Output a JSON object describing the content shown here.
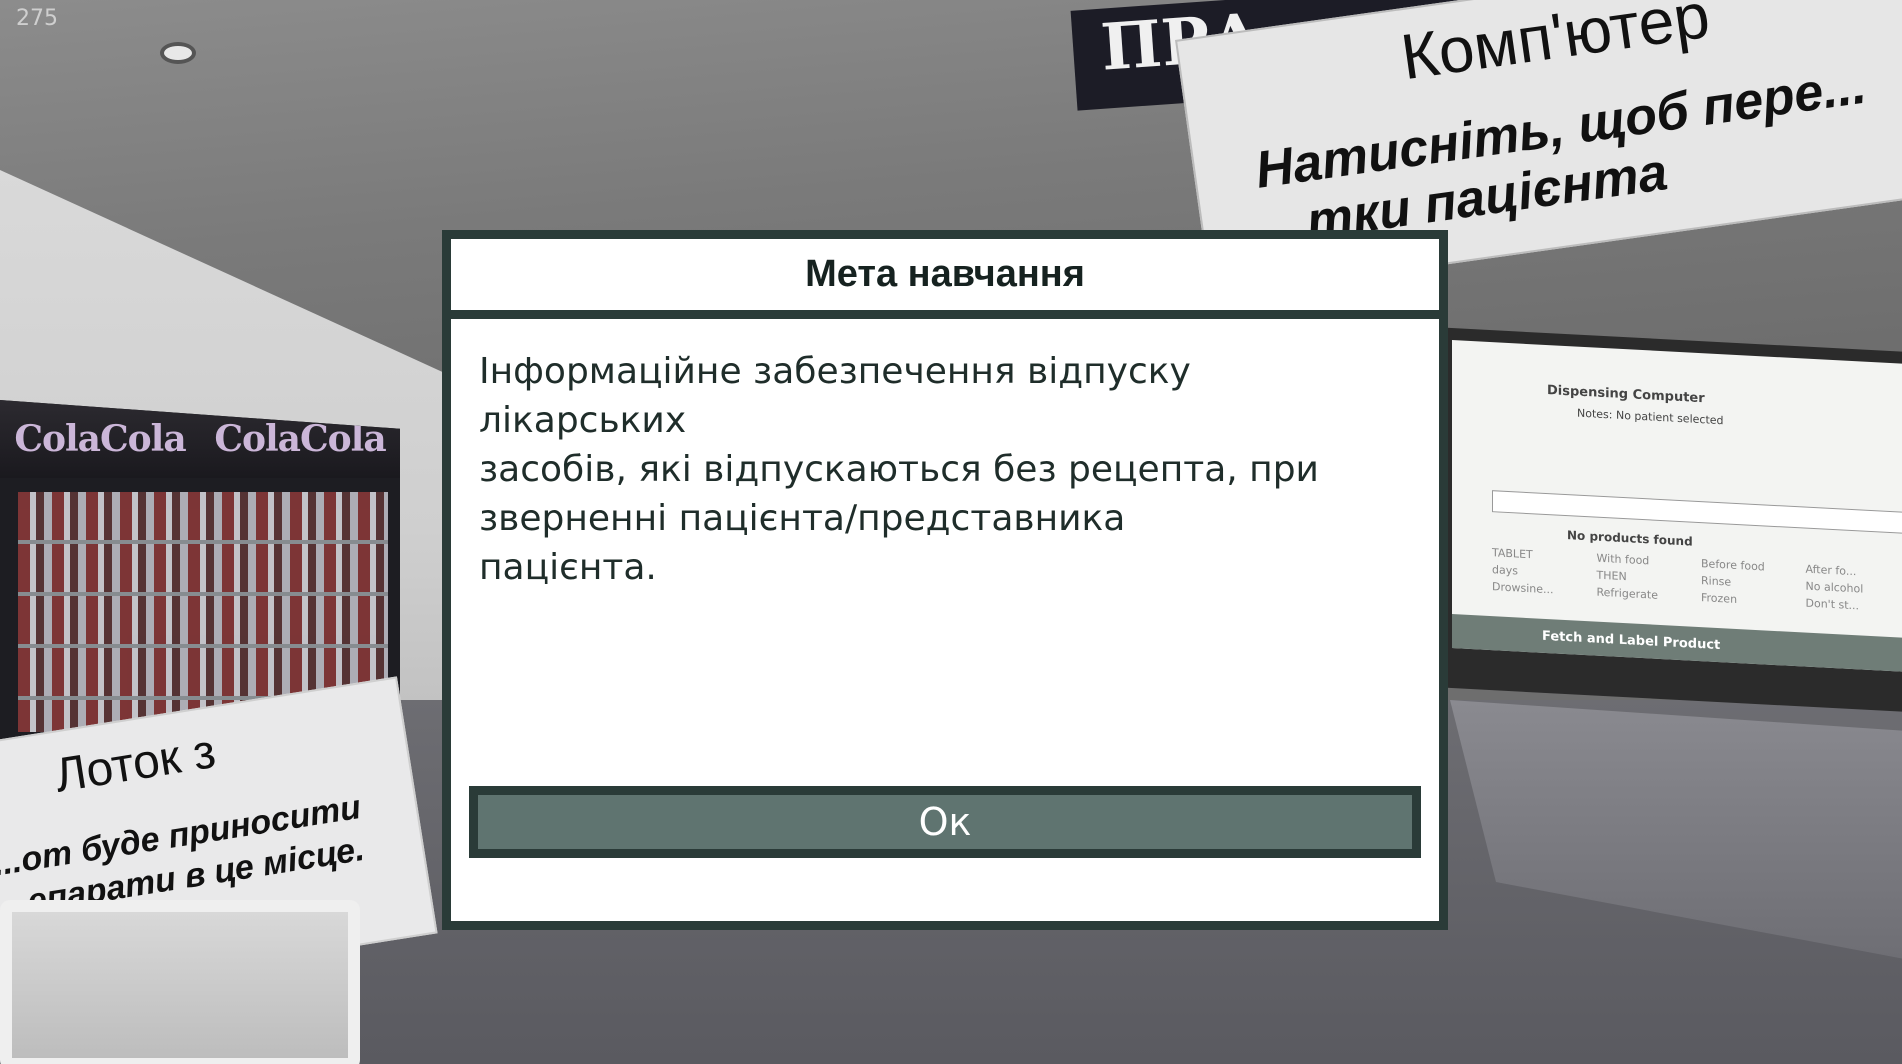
{
  "hud": {
    "fps_counter": "275"
  },
  "scene": {
    "fridge_brand": [
      "ColaCola",
      "ColaCola"
    ],
    "top_sign_text": "ПРА",
    "computer_panel": {
      "title": "Комп'ютер",
      "text": "Натисніть, щоб пере... ...тки пацієнта"
    },
    "tray_panel": {
      "title": "Лоток з",
      "text": "...от буде приносити ...епарати в це місце."
    },
    "monitor": {
      "title": "Dispensing Computer",
      "notes": "Notes: No patient selected",
      "no_products": "No products found",
      "options": [
        "TABLET",
        "With food",
        "Before food",
        "After fo...",
        "days",
        "THEN",
        "Rinse",
        "No alcohol",
        "Drowsine...",
        "Refrigerate",
        "Frozen",
        "Don't st..."
      ],
      "footer": "Fetch and Label Product"
    }
  },
  "dialog": {
    "title": "Мета навчання",
    "body": "Інформаційне забезпечення відпуску лікарських\nзасобів, які відпускаються без рецепта, при\nзверненні пацієнта/представника\nпацієнта.",
    "ok_label": "Ок"
  }
}
